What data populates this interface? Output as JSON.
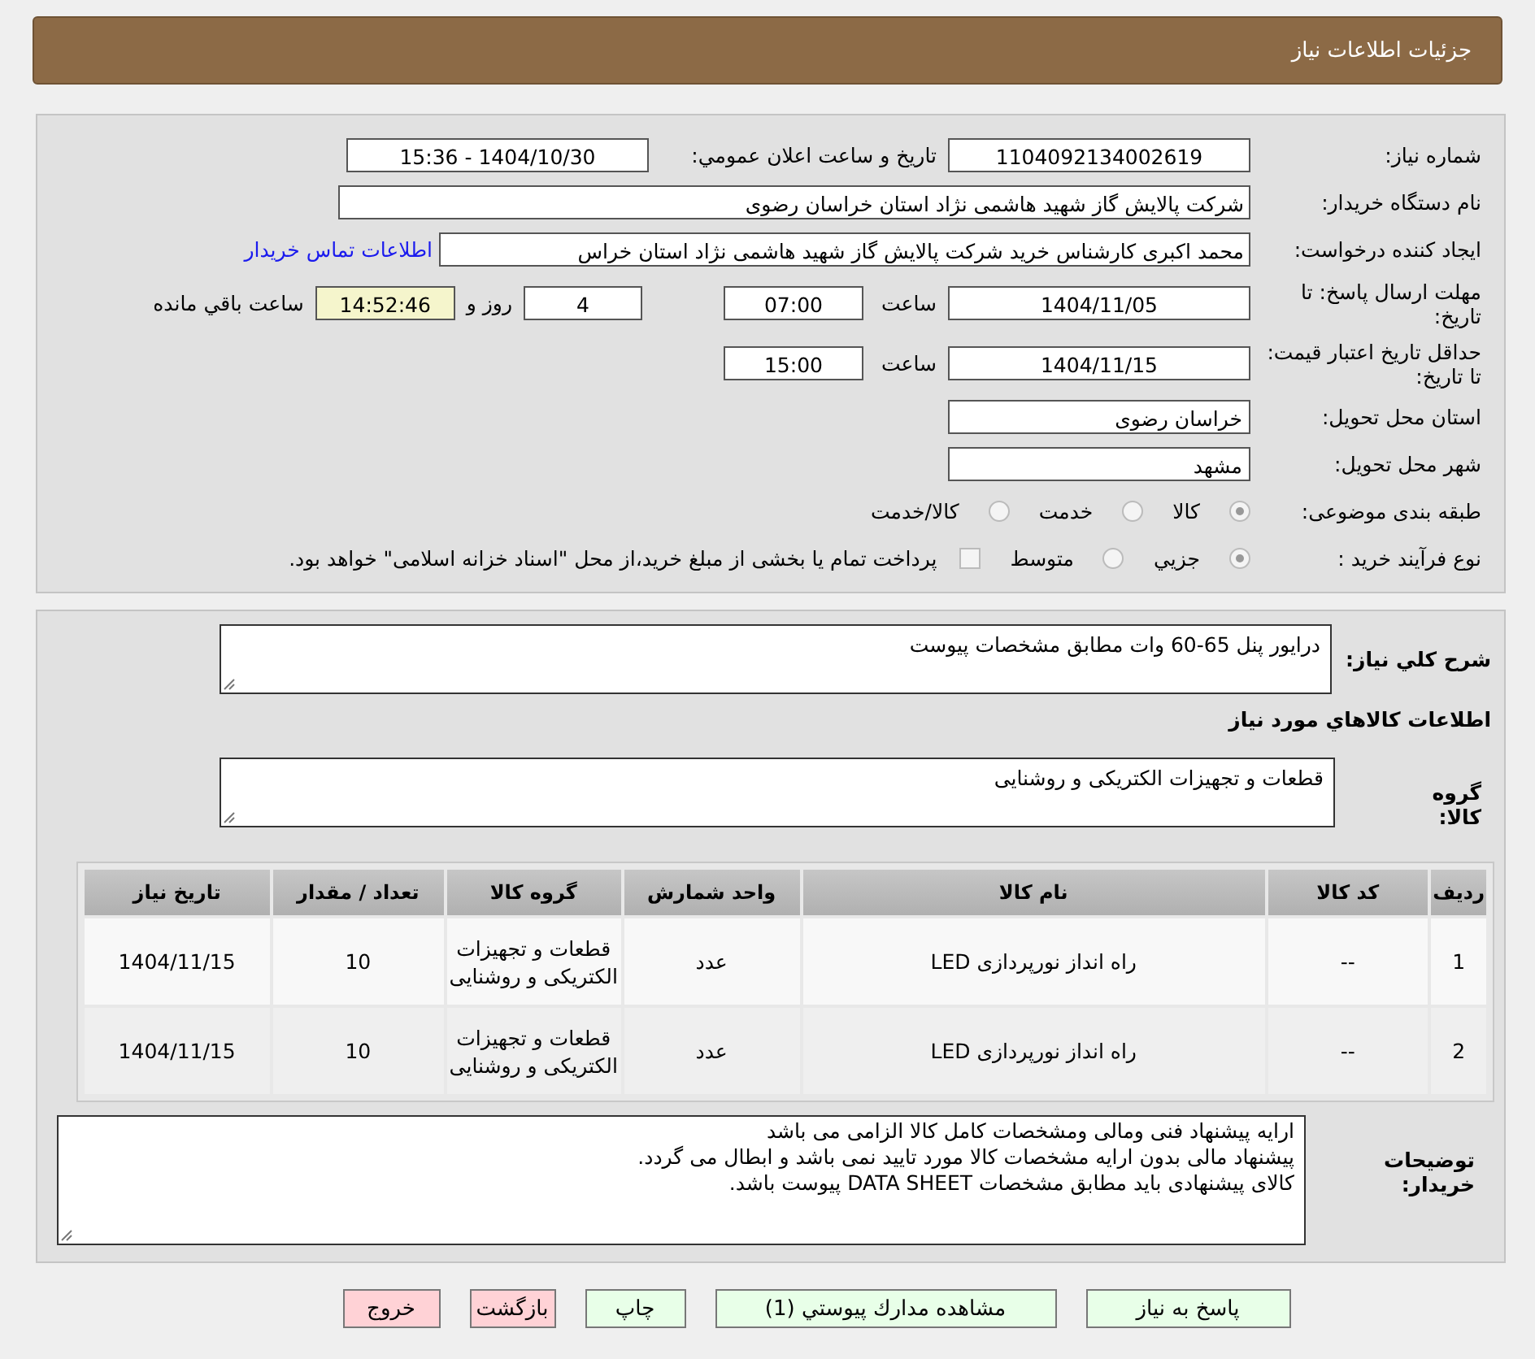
{
  "header": {
    "title": "جزئیات اطلاعات نیاز"
  },
  "need_number": {
    "label": "شماره نیاز:",
    "value": "1104092134002619"
  },
  "announce": {
    "label": "تاریخ و ساعت اعلان عمومي:",
    "value": "1404/10/30 - 15:36"
  },
  "buyer_org": {
    "label": "نام دستگاه خریدار:",
    "value": "شرکت پالایش گاز شهید هاشمی نژاد   استان خراسان رضوی"
  },
  "creator": {
    "label": "ایجاد کننده درخواست:",
    "value": "محمد اکبری کارشناس خرید شرکت پالایش گاز شهید هاشمی نژاد   استان خراس",
    "link": "اطلاعات تماس خریدار"
  },
  "deadline": {
    "label": "مهلت ارسال پاسخ: تا تاریخ:",
    "date": "1404/11/05",
    "time_label": "ساعت",
    "time": "07:00",
    "days": "4",
    "days_label": "روز و",
    "remaining": "14:52:46",
    "remaining_label": "ساعت باقي مانده"
  },
  "validity": {
    "label": "حداقل تاریخ اعتبار قیمت: تا تاریخ:",
    "date": "1404/11/15",
    "time_label": "ساعت",
    "time": "15:00"
  },
  "province": {
    "label": "استان محل تحویل:",
    "value": "خراسان رضوی"
  },
  "city": {
    "label": "شهر محل تحویل:",
    "value": "مشهد"
  },
  "category": {
    "label": "طبقه بندی موضوعی:",
    "options": [
      {
        "label": "کالا",
        "selected": true
      },
      {
        "label": "خدمت",
        "selected": false
      },
      {
        "label": "کالا/خدمت",
        "selected": false
      }
    ]
  },
  "process": {
    "label": "نوع فرآیند خرید :",
    "options": [
      {
        "label": "جزيي",
        "selected": true
      },
      {
        "label": "متوسط",
        "selected": false
      }
    ],
    "payment": {
      "checked": false,
      "text": "پرداخت تمام یا بخشی از مبلغ خرید،از محل \"اسناد خزانه اسلامی\" خواهد بود."
    }
  },
  "description": {
    "label": "شرح کلي نیاز:",
    "value": "درایور پنل  65-60 وات مطابق مشخصات پیوست"
  },
  "goods_heading": "اطلاعات کالاهاي مورد نیاز",
  "goods_group": {
    "label": "گروه کالا:",
    "value": "قطعات و تجهیزات الکتریکی و روشنایی"
  },
  "table": {
    "columns": [
      "ردیف",
      "کد کالا",
      "نام کالا",
      "واحد شمارش",
      "گروه کالا",
      "تعداد / مقدار",
      "تاریخ نیاز"
    ],
    "rows": [
      [
        "1",
        "--",
        "راه انداز نورپردازی LED",
        "عدد",
        "قطعات و تجهیزات الکتریکی و روشنایی",
        "10",
        "1404/11/15"
      ],
      [
        "2",
        "--",
        "راه انداز نورپردازی LED",
        "عدد",
        "قطعات و تجهیزات الکتریکی و روشنایی",
        "10",
        "1404/11/15"
      ]
    ]
  },
  "buyer_notes": {
    "label": "توضیحات خریدار:",
    "lines": [
      "ارایه پیشنهاد فنی ومالی ومشخصات کامل کالا الزامی می باشد",
      "پیشنهاد مالی بدون ارایه مشخصات کالا مورد تایید نمی باشد و ابطال می گردد.",
      "کالای پیشنهادی باید مطابق مشخصات DATA SHEET پیوست باشد."
    ]
  },
  "buttons": [
    {
      "label": "پاسخ به نیاز",
      "kind": "normal"
    },
    {
      "label": "مشاهده مدارك پيوستي (1)",
      "kind": "normal"
    },
    {
      "label": "چاپ",
      "kind": "normal"
    },
    {
      "label": "بازگشت",
      "kind": "exit"
    },
    {
      "label": "خروج",
      "kind": "exit"
    }
  ]
}
